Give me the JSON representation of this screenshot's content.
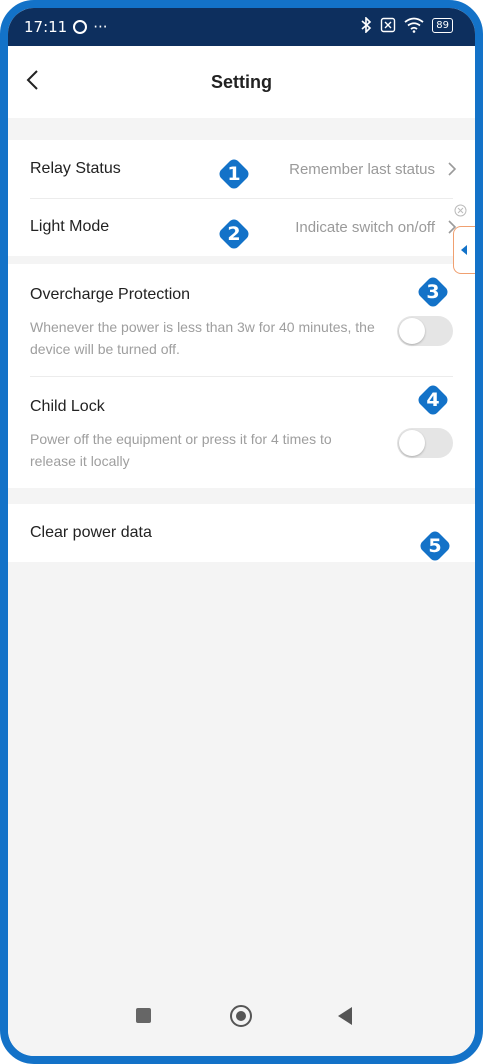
{
  "status_bar": {
    "time": "17:11",
    "more": "···",
    "battery": "89"
  },
  "header": {
    "title": "Setting"
  },
  "settings": {
    "relay_status": {
      "label": "Relay Status",
      "value": "Remember last status"
    },
    "light_mode": {
      "label": "Light Mode",
      "value": "Indicate switch on/off"
    },
    "overcharge_protection": {
      "label": "Overcharge Protection",
      "description": "Whenever the power is less than 3w for 40 minutes, the device will be turned off.",
      "enabled": false
    },
    "child_lock": {
      "label": "Child Lock",
      "description": "Power off the equipment or press it for 4 times to release it locally",
      "enabled": false
    },
    "clear_power_data": {
      "label": "Clear power data"
    }
  },
  "badges": [
    "1",
    "2",
    "3",
    "4",
    "5"
  ],
  "colors": {
    "frame": "#1372c8",
    "badge": "#1372c8",
    "status_bar": "#0d2f5e"
  },
  "icons": {
    "back": "chevron-left-icon",
    "chevron": "chevron-right-icon",
    "nav_recent": "square-icon",
    "nav_home": "circle-icon",
    "nav_back": "triangle-back-icon"
  }
}
